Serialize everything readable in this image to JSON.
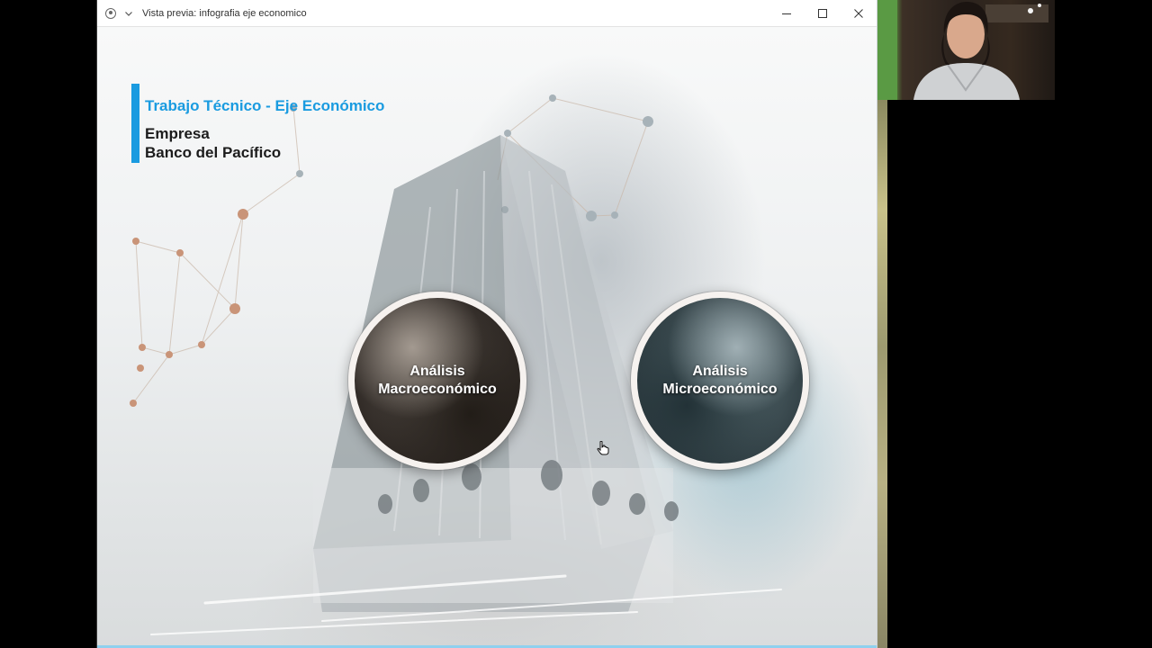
{
  "window": {
    "title": "Vista previa: infografia eje economico",
    "controls": {
      "minimize_icon": "minimize-icon",
      "maximize_icon": "maximize-icon",
      "close_icon": "close-icon"
    }
  },
  "slide": {
    "heading": "Trabajo Técnico - Eje Económico",
    "line1": "Empresa",
    "line2": "Banco del Pacífico",
    "accent_color": "#1a9be0",
    "buttons": [
      {
        "line1": "Análisis",
        "line2": "Macroeconómico"
      },
      {
        "line1": "Análisis",
        "line2": "Microeconómico"
      }
    ]
  },
  "webcam": {
    "description_icon": "person-icon"
  }
}
